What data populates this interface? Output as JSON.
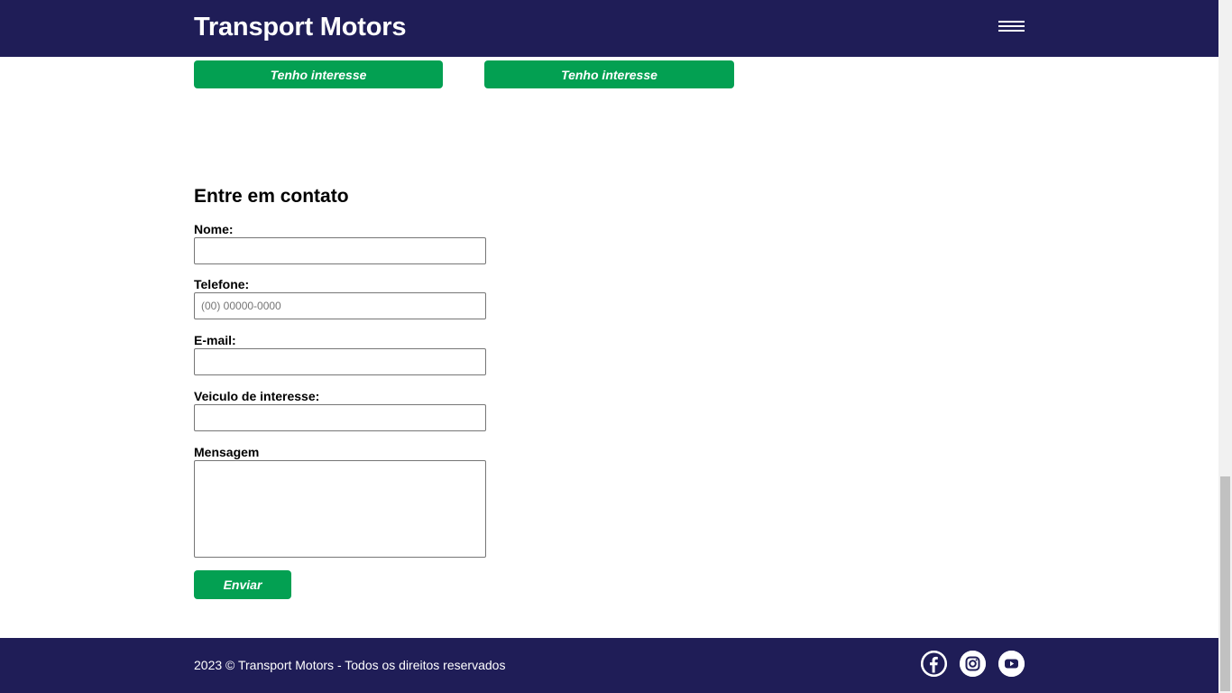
{
  "header": {
    "brand": "Transport Motors",
    "menu_icon": "hamburger-menu-icon"
  },
  "cards": {
    "buttons": [
      "Tenho interesse",
      "Tenho interesse"
    ]
  },
  "contact": {
    "title": "Entre em contato",
    "fields": {
      "nome": {
        "label": "Nome:",
        "value": ""
      },
      "telefone": {
        "label": "Telefone:",
        "placeholder": "(00) 00000-0000",
        "value": ""
      },
      "email": {
        "label": "E-mail:",
        "value": ""
      },
      "veiculo": {
        "label": "Veiculo de interesse:",
        "value": ""
      },
      "mensagem": {
        "label": "Mensagem",
        "value": ""
      }
    },
    "submit_label": "Enviar"
  },
  "footer": {
    "copyright": "2023 © Transport Motors - Todos os direitos reservados",
    "social": [
      "facebook-icon",
      "instagram-icon",
      "youtube-icon"
    ]
  },
  "colors": {
    "navy": "#1f1d57",
    "green": "#03a052",
    "white": "#ffffff"
  }
}
